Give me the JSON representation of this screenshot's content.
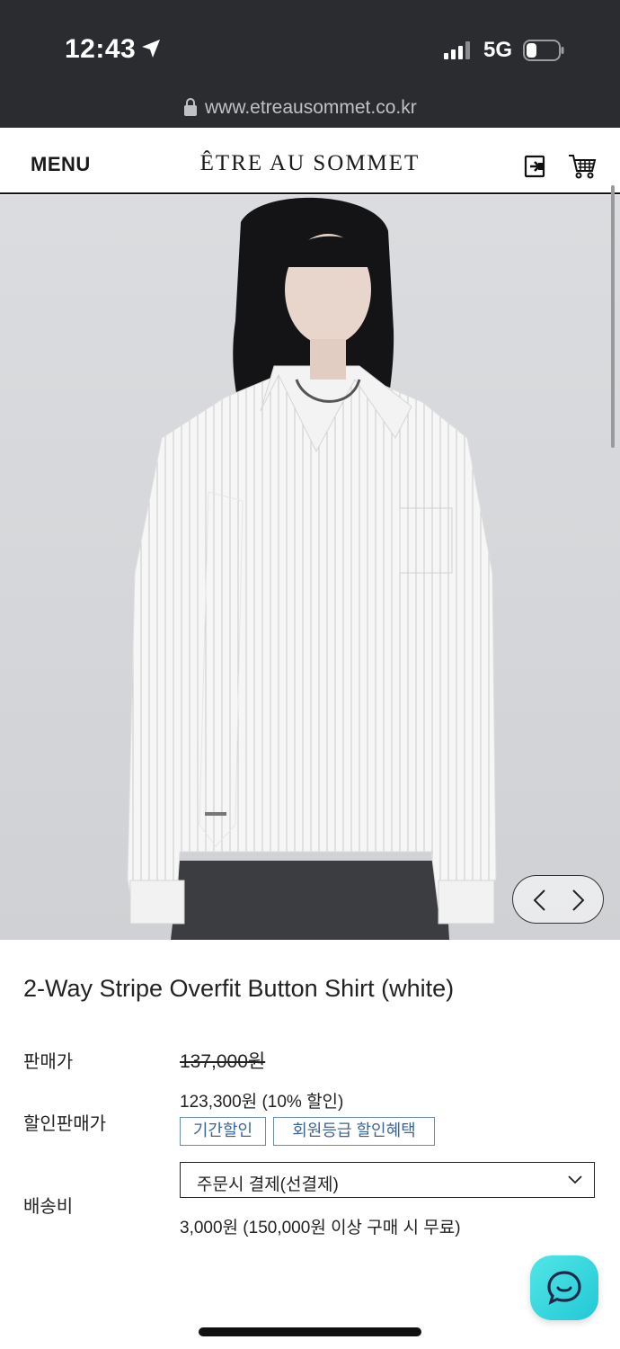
{
  "status_bar": {
    "time": "12:43",
    "network": "5G",
    "icons": [
      "location-arrow-icon",
      "signal-icon",
      "battery-icon"
    ]
  },
  "browser": {
    "url": "www.etreausommet.co.kr",
    "icons": [
      "lock-icon"
    ]
  },
  "header": {
    "menu_label": "MENU",
    "brand": "ÊTRE AU SOMMET",
    "icons": [
      "login-icon",
      "cart-icon"
    ]
  },
  "carousel": {
    "icons": [
      "chevron-left-icon",
      "chevron-right-icon"
    ]
  },
  "product": {
    "title": "2-Way Stripe Overfit Button Shirt (white)",
    "price_label": "판매가",
    "price_original": "137,000원",
    "discount_label": "할인판매가",
    "price_sale": "123,300원 (10% 할인)",
    "badges": [
      "기간할인",
      "회원등급 할인혜택"
    ],
    "shipping_label": "배송비",
    "shipping_option": "주문시 결제(선결제)",
    "shipping_note": "3,000원 (150,000원 이상 구매 시 무료)"
  },
  "chat": {
    "icon": "chat-icon",
    "color": "#34d6df"
  },
  "colors": {
    "status_bg": "#2a2c30",
    "badge_border": "#6a8bb0",
    "badge_text": "#3a6596"
  }
}
